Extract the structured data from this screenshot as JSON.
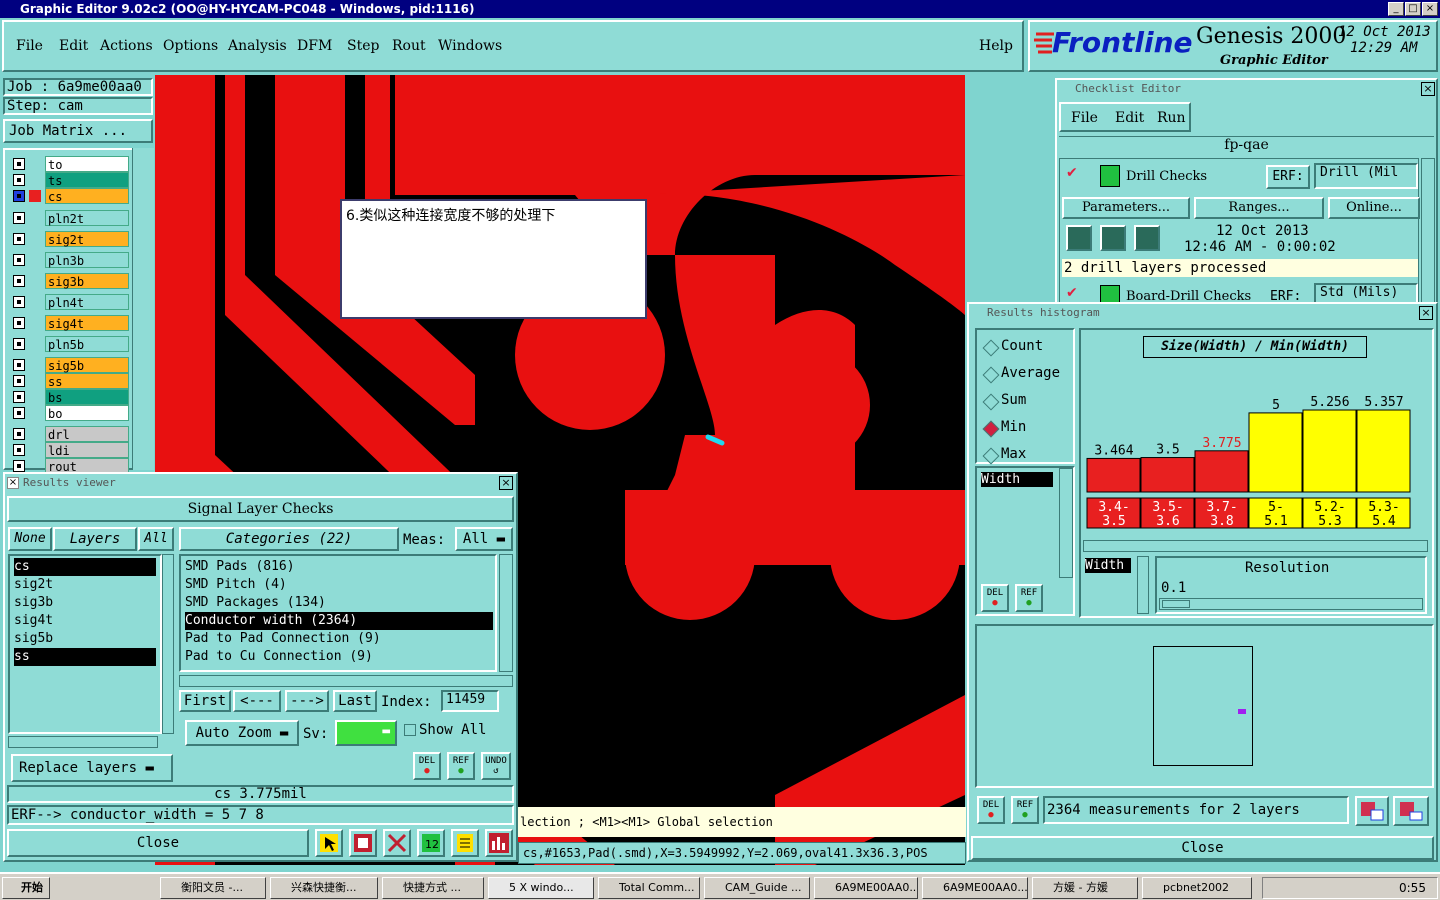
{
  "window": {
    "title": "Graphic Editor 9.02c2 (OO@HY-HYCAM-PC048 - Windows, pid:1116)"
  },
  "menu": [
    "File",
    "Edit",
    "Actions",
    "Options",
    "Analysis",
    "DFM",
    "Step",
    "Rout",
    "Windows"
  ],
  "help": "Help",
  "brand": {
    "logo": "Frontline",
    "product": "Genesis 2000",
    "subtitle": "Graphic Editor",
    "date": "12 Oct 2013",
    "time": "12:29 AM"
  },
  "job": {
    "job_label": "Job : 6a9me00aa0",
    "step_label": "Step: cam",
    "matrix_button": "Job Matrix ..."
  },
  "layers": [
    {
      "name": "to",
      "color": "#ffffff"
    },
    {
      "name": "ts",
      "color": "#10a080"
    },
    {
      "name": "cs",
      "color": "#ffb020"
    },
    {
      "name": "pln2t",
      "color": "#8fdcd6"
    },
    {
      "name": "sig2t",
      "color": "#ffb020"
    },
    {
      "name": "pln3b",
      "color": "#8fdcd6"
    },
    {
      "name": "sig3b",
      "color": "#ffb020"
    },
    {
      "name": "pln4t",
      "color": "#8fdcd6"
    },
    {
      "name": "sig4t",
      "color": "#ffb020"
    },
    {
      "name": "pln5b",
      "color": "#8fdcd6"
    },
    {
      "name": "sig5b",
      "color": "#ffb020"
    },
    {
      "name": "ss",
      "color": "#ffb020"
    },
    {
      "name": "bs",
      "color": "#10a080"
    },
    {
      "name": "bo",
      "color": "#ffffff"
    },
    {
      "name": "drl",
      "color": "#c8c8c8"
    },
    {
      "name": "ldi",
      "color": "#c8c8c8"
    },
    {
      "name": "rout",
      "color": "#c8c8c8"
    }
  ],
  "annotation": "6.类似这种连接宽度不够的处理下",
  "results_viewer": {
    "title": "Results viewer",
    "header": "Signal Layer Checks",
    "none": "None",
    "layers": "Layers",
    "all": "All",
    "categories_header": "Categories (22)",
    "meas_label": "Meas:",
    "meas_value": "All",
    "layer_list": [
      "cs",
      "sig2t",
      "sig3b",
      "sig4t",
      "sig5b",
      "ss"
    ],
    "categories": [
      "SMD Pads (816)",
      "SMD Pitch (4)",
      "SMD Packages (134)",
      "Conductor width (2364)",
      "Pad to Pad Connection (9)",
      "Pad to Cu Connection (9)"
    ],
    "first": "First",
    "prev": "<---",
    "next": "--->",
    "last": "Last",
    "index_label": "Index:",
    "index_value": "11459",
    "auto_zoom": "Auto Zoom",
    "sv": "Sv:",
    "show_all": "Show All",
    "replace_layers": "Replace layers",
    "status": "cs 3.775mil",
    "erf": "ERF--> conductor_width = 5 7 8",
    "close": "Close",
    "del": "DEL",
    "ref": "REF",
    "undo": "UNDO"
  },
  "status_bar": {
    "selection": "lection ; <M1><M1> Global selection",
    "coords": "cs,#1653,Pad(.smd),X=3.5949992,Y=2.069,oval41.3x36.3,POS"
  },
  "checklist": {
    "title": "Checklist Editor",
    "menu": [
      "File",
      "Edit",
      "Run"
    ],
    "name": "fp-qae",
    "drill_checks": "Drill Checks",
    "erf": "ERF:",
    "drill_erf": "Drill (Mil",
    "parameters": "Parameters...",
    "ranges": "Ranges...",
    "online": "Online...",
    "date": "12 Oct 2013",
    "time": "12:46 AM - 0:00:02",
    "processed": "2 drill layers processed",
    "board_drill": "Board-Drill Checks",
    "board_erf": "Std (Mils)"
  },
  "histogram": {
    "title": "Results histogram",
    "modes": [
      "Count",
      "Average",
      "Sum",
      "Min",
      "Max"
    ],
    "selected_mode": "Min",
    "chart_title": "Size(Width) / Min(Width)",
    "field": "Width",
    "resolution_label": "Resolution",
    "resolution_value": "0.1",
    "summary": "2364 measurements for 2 layers",
    "close": "Close",
    "del": "DEL",
    "ref": "REF"
  },
  "chart_data": {
    "type": "bar",
    "title": "Size(Width) / Min(Width)",
    "categories": [
      "3.4-3.5",
      "3.5-3.6",
      "3.7-3.8",
      "5-5.1",
      "5.2-5.3",
      "5.3-5.4"
    ],
    "values": [
      3.464,
      3.5,
      3.775,
      5,
      5.256,
      5.357
    ],
    "value_labels": [
      "3.464",
      "3.5",
      "3.775",
      "5",
      "5.256",
      "5.357"
    ],
    "bar_colors": [
      "#e82020",
      "#e82020",
      "#e82020",
      "#ffff00",
      "#ffff00",
      "#ffff00"
    ],
    "category_labels": [
      [
        "3.4-",
        "3.5"
      ],
      [
        "3.5-",
        "3.6"
      ],
      [
        "3.7-",
        "3.8"
      ],
      [
        "5-",
        "5.1"
      ],
      [
        "5.2-",
        "5.3"
      ],
      [
        "5.3-",
        "5.4"
      ]
    ]
  },
  "taskbar": {
    "start": "开始",
    "tasks": [
      "衡阳文员 -...",
      "兴森快捷衡...",
      "快捷方式 ...",
      "5 X windo...",
      "Total Comm...",
      "CAM_Guide ...",
      "6A9ME00AA0...",
      "6A9ME00AA0...",
      "方媛 - 方媛",
      "pcbnet2002"
    ],
    "clock": "0:55"
  }
}
